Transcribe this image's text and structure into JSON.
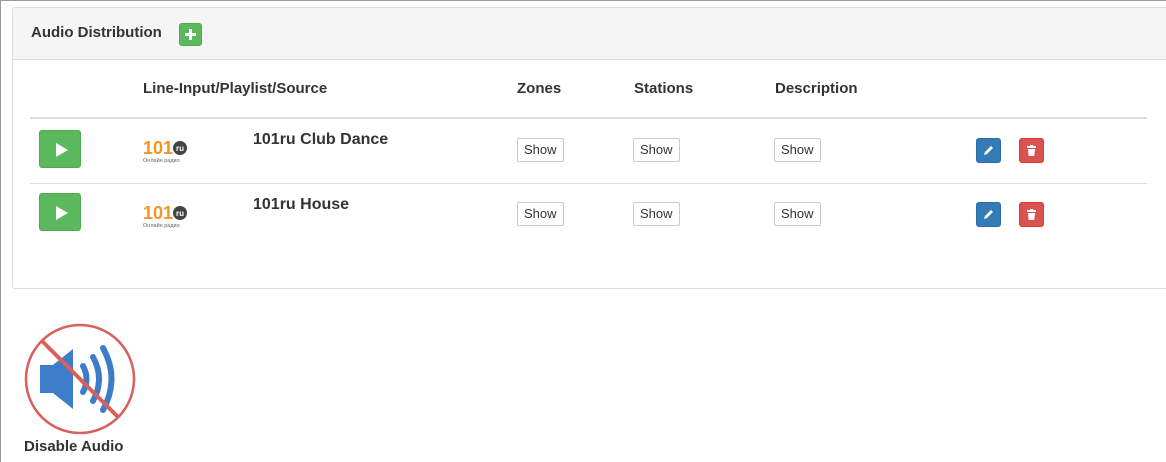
{
  "panel": {
    "title": "Audio Distribution"
  },
  "table": {
    "headers": {
      "source": "Line-Input/Playlist/Source",
      "zones": "Zones",
      "stations": "Stations",
      "description": "Description"
    },
    "rows": [
      {
        "name": "101ru Club Dance",
        "logo_text": "101",
        "logo_badge": "ru",
        "logo_caption": "Онлайн радио",
        "zones_btn": "Show",
        "stations_btn": "Show",
        "description_btn": "Show"
      },
      {
        "name": "101ru House",
        "logo_text": "101",
        "logo_badge": "ru",
        "logo_caption": "Онлайн радио",
        "zones_btn": "Show",
        "stations_btn": "Show",
        "description_btn": "Show"
      }
    ]
  },
  "disable_audio": {
    "label": "Disable Audio"
  },
  "colors": {
    "success": "#5cb85c",
    "primary": "#337ab7",
    "danger": "#d9534f",
    "logo_orange": "#f7941d",
    "speaker_blue": "#3d7cc9",
    "forbid_red": "#d9605a"
  },
  "icons": {
    "add": "plus-icon",
    "play": "play-icon",
    "edit": "pencil-icon",
    "delete": "trash-icon",
    "disable": "speaker-muted-icon"
  }
}
